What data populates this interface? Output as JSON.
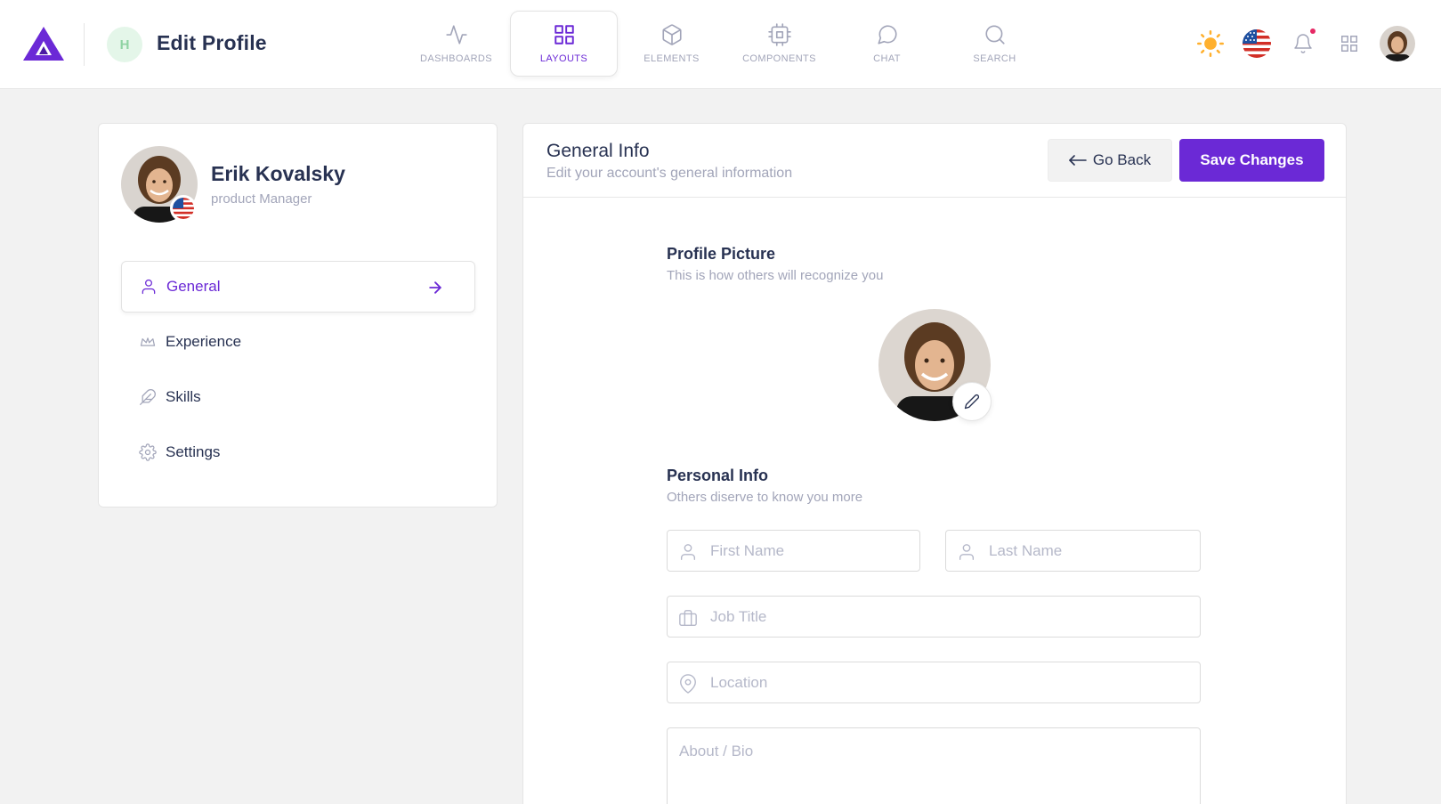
{
  "header": {
    "title": "Edit Profile",
    "user_initial": "H",
    "nav": [
      {
        "label": "DASHBOARDS",
        "icon": "activity-icon",
        "active": false
      },
      {
        "label": "LAYOUTS",
        "icon": "grid-icon",
        "active": true
      },
      {
        "label": "ELEMENTS",
        "icon": "box-icon",
        "active": false
      },
      {
        "label": "COMPONENTS",
        "icon": "cpu-icon",
        "active": false
      },
      {
        "label": "CHAT",
        "icon": "message-circle-icon",
        "active": false
      },
      {
        "label": "SEARCH",
        "icon": "search-icon",
        "active": false
      }
    ]
  },
  "profile": {
    "name": "Erik Kovalsky",
    "role": "product Manager"
  },
  "menu": [
    {
      "label": "General",
      "icon": "user-icon",
      "active": true
    },
    {
      "label": "Experience",
      "icon": "crown-icon",
      "active": false
    },
    {
      "label": "Skills",
      "icon": "feather-icon",
      "active": false
    },
    {
      "label": "Settings",
      "icon": "settings-icon",
      "active": false
    }
  ],
  "general": {
    "title": "General Info",
    "subtitle": "Edit your account's general information",
    "back_label": "Go Back",
    "save_label": "Save Changes",
    "picture_title": "Profile Picture",
    "picture_subtitle": "This is how others will recognize you",
    "personal_title": "Personal Info",
    "personal_subtitle": "Others diserve to know you more"
  },
  "form": {
    "first_name": {
      "placeholder": "First Name",
      "value": ""
    },
    "last_name": {
      "placeholder": "Last Name",
      "value": ""
    },
    "job_title": {
      "placeholder": "Job Title",
      "value": ""
    },
    "location": {
      "placeholder": "Location",
      "value": ""
    },
    "bio": {
      "placeholder": "About / Bio",
      "value": ""
    }
  },
  "colors": {
    "accent": "#6b29d6",
    "text": "#283252",
    "muted": "#a2a5b9",
    "sun": "#ffb02e",
    "notification": "#e62965"
  }
}
